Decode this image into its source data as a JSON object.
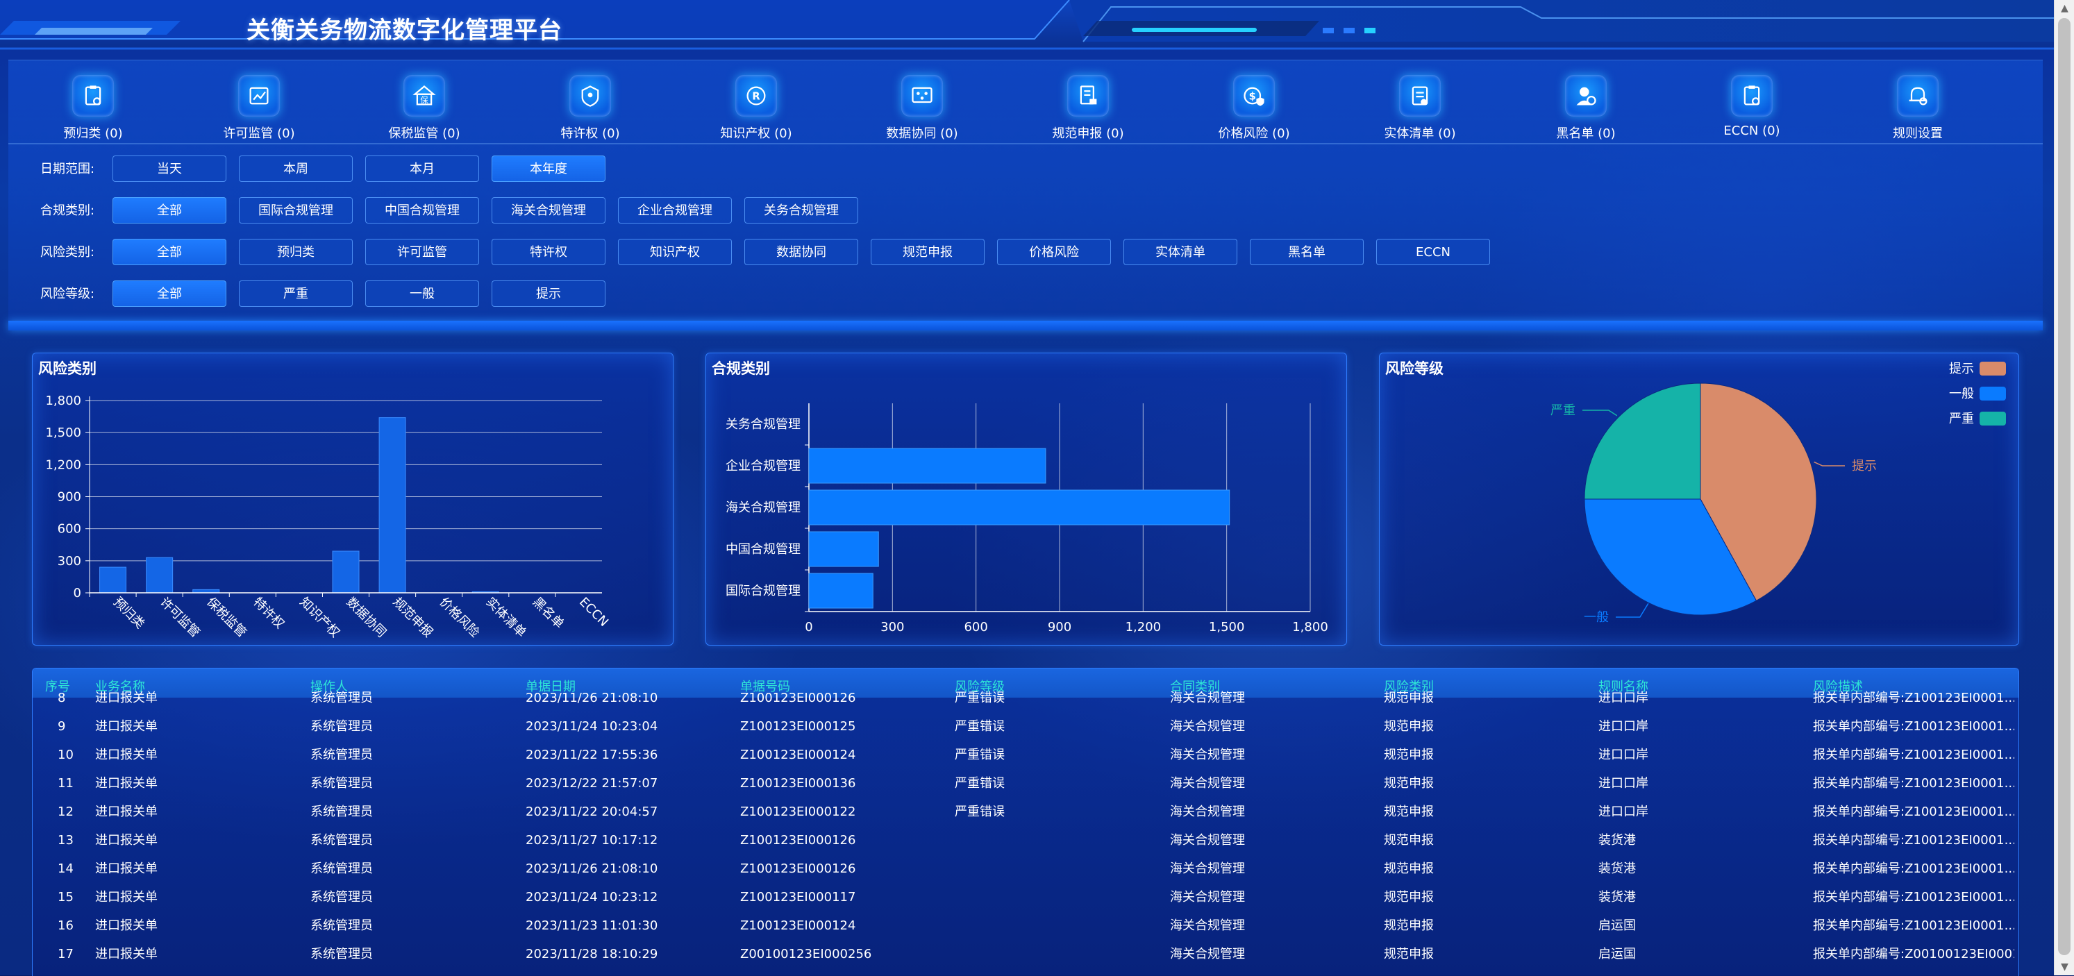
{
  "app": {
    "title": "关衡关务物流数字化管理平台"
  },
  "nav": [
    {
      "label": "预归类 (0)",
      "icon": "clipboard-gear-icon"
    },
    {
      "label": "许可监管 (0)",
      "icon": "chart-trend-icon"
    },
    {
      "label": "保税监管 (0)",
      "icon": "bonded-house-icon"
    },
    {
      "label": "特许权 (0)",
      "icon": "shield-pin-icon"
    },
    {
      "label": "知识产权 (0)",
      "icon": "registered-mark-icon"
    },
    {
      "label": "数据协同 (0)",
      "icon": "network-nodes-icon"
    },
    {
      "label": "规范申报 (0)",
      "icon": "document-stamp-icon"
    },
    {
      "label": "价格风险 (0)",
      "icon": "dollar-shield-icon"
    },
    {
      "label": "实体清单 (0)",
      "icon": "clipboard-check-icon"
    },
    {
      "label": "黑名单 (0)",
      "icon": "user-blocked-icon"
    },
    {
      "label": "ECCN (0)",
      "icon": "clipboard-gear-icon"
    },
    {
      "label": "规则设置",
      "icon": "bell-gear-icon"
    }
  ],
  "filters": [
    {
      "label": "日期范围:",
      "options": [
        "当天",
        "本周",
        "本月",
        "本年度"
      ],
      "active": 3
    },
    {
      "label": "合规类别:",
      "options": [
        "全部",
        "国际合规管理",
        "中国合规管理",
        "海关合规管理",
        "企业合规管理",
        "关务合规管理"
      ],
      "active": 0
    },
    {
      "label": "风险类别:",
      "options": [
        "全部",
        "预归类",
        "许可监管",
        "特许权",
        "知识产权",
        "数据协同",
        "规范申报",
        "价格风险",
        "实体清单",
        "黑名单",
        "ECCN"
      ],
      "active": 0
    },
    {
      "label": "风险等级:",
      "options": [
        "全部",
        "严重",
        "一般",
        "提示"
      ],
      "active": 0
    }
  ],
  "charts": {
    "risk_category_title": "风险类别",
    "compliance_category_title": "合规类别",
    "risk_level_title": "风险等级"
  },
  "chart_data": [
    {
      "type": "bar",
      "title": "风险类别",
      "categories": [
        "预归类",
        "许可监管",
        "保税监管",
        "特许权",
        "知识产权",
        "数据协同",
        "规范申报",
        "价格风险",
        "实体清单",
        "黑名单",
        "ECCN"
      ],
      "values": [
        240,
        330,
        30,
        0,
        0,
        390,
        1640,
        0,
        10,
        0,
        0
      ],
      "yticks": [
        "0",
        "300",
        "600",
        "900",
        "1,200",
        "1,500",
        "1,800"
      ],
      "ylim": [
        0,
        1800
      ],
      "bar_color": "#1466e6"
    },
    {
      "type": "bar",
      "orientation": "horizontal",
      "title": "合规类别",
      "categories": [
        "国际合规管理",
        "中国合规管理",
        "海关合规管理",
        "企业合规管理",
        "关务合规管理"
      ],
      "values": [
        230,
        250,
        1510,
        850,
        0
      ],
      "xticks": [
        "0",
        "300",
        "600",
        "900",
        "1,200",
        "1,500",
        "1,800"
      ],
      "xlim": [
        0,
        1800
      ],
      "bar_color": "#0a7bff"
    },
    {
      "type": "pie",
      "title": "风险等级",
      "slices": [
        {
          "label": "提示",
          "value": 42,
          "color": "#d98b6a"
        },
        {
          "label": "一般",
          "value": 33,
          "color": "#0a7bff"
        },
        {
          "label": "严重",
          "value": 25,
          "color": "#15b3a8"
        }
      ],
      "legend": [
        "提示",
        "一般",
        "严重"
      ],
      "legend_position": "top-right"
    }
  ],
  "table": {
    "headers": [
      "序号",
      "业务名称",
      "操作人",
      "单据日期",
      "单据号码",
      "风险等级",
      "合同类别",
      "风险类别",
      "规则名称",
      "风险描述"
    ],
    "rows": [
      [
        "8",
        "进口报关单",
        "系统管理员",
        "2023/11/26 21:08:10",
        "Z100123EI000126",
        "严重错误",
        "海关合规管理",
        "规范申报",
        "进口口岸",
        "报关单内部编号:Z100123EI0001..."
      ],
      [
        "9",
        "进口报关单",
        "系统管理员",
        "2023/11/24 10:23:04",
        "Z100123EI000125",
        "严重错误",
        "海关合规管理",
        "规范申报",
        "进口口岸",
        "报关单内部编号:Z100123EI0001..."
      ],
      [
        "10",
        "进口报关单",
        "系统管理员",
        "2023/11/22 17:55:36",
        "Z100123EI000124",
        "严重错误",
        "海关合规管理",
        "规范申报",
        "进口口岸",
        "报关单内部编号:Z100123EI0001..."
      ],
      [
        "11",
        "进口报关单",
        "系统管理员",
        "2023/12/22 21:57:07",
        "Z100123EI000136",
        "严重错误",
        "海关合规管理",
        "规范申报",
        "进口口岸",
        "报关单内部编号:Z100123EI0001..."
      ],
      [
        "12",
        "进口报关单",
        "系统管理员",
        "2023/11/22 20:04:57",
        "Z100123EI000122",
        "严重错误",
        "海关合规管理",
        "规范申报",
        "进口口岸",
        "报关单内部编号:Z100123EI0001..."
      ],
      [
        "13",
        "进口报关单",
        "系统管理员",
        "2023/11/27 10:17:12",
        "Z100123EI000126",
        "",
        "海关合规管理",
        "规范申报",
        "装货港",
        "报关单内部编号:Z100123EI0001..."
      ],
      [
        "14",
        "进口报关单",
        "系统管理员",
        "2023/11/26 21:08:10",
        "Z100123EI000126",
        "",
        "海关合规管理",
        "规范申报",
        "装货港",
        "报关单内部编号:Z100123EI0001..."
      ],
      [
        "15",
        "进口报关单",
        "系统管理员",
        "2023/11/24 10:23:12",
        "Z100123EI000117",
        "",
        "海关合规管理",
        "规范申报",
        "装货港",
        "报关单内部编号:Z100123EI0001..."
      ],
      [
        "16",
        "进口报关单",
        "系统管理员",
        "2023/11/23 11:01:30",
        "Z100123EI000124",
        "",
        "海关合规管理",
        "规范申报",
        "启运国",
        "报关单内部编号:Z100123EI0001..."
      ],
      [
        "17",
        "进口报关单",
        "系统管理员",
        "2023/11/28 18:10:29",
        "Z00100123EI000256",
        "",
        "海关合规管理",
        "规范申报",
        "启运国",
        "报关单内部编号:Z00100123EI0001..."
      ]
    ]
  }
}
